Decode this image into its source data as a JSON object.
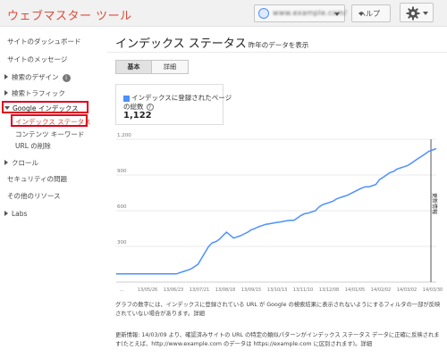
{
  "header": {
    "app_title": "ウェブマスター ツール",
    "site_selector": "www.example.com/",
    "help_label": "ヘルプ"
  },
  "sidebar": {
    "items": [
      {
        "label": "サイトのダッシュボード"
      },
      {
        "label": "サイトのメッセージ"
      },
      {
        "label": "検索のデザイン"
      },
      {
        "label": "検索トラフィック"
      },
      {
        "label": "Google インデックス"
      },
      {
        "label": "インデックス ステータス"
      },
      {
        "label": "コンテンツ キーワード"
      },
      {
        "label": "URL の削除"
      },
      {
        "label": "クロール"
      },
      {
        "label": "セキュリティの問題"
      },
      {
        "label": "その他のリソース"
      },
      {
        "label": "Labs"
      }
    ]
  },
  "main": {
    "title": "インデックス ステータス",
    "subtitle": "昨年のデータを表示",
    "tabs": [
      {
        "label": "基本"
      },
      {
        "label": "詳細"
      }
    ],
    "stat": {
      "label_line1": "インデックスに登録されたページ",
      "label_line2": "の総数",
      "value": "1,122",
      "legend_color": "#4d90fe"
    },
    "note1": "グラフの数字には、インデックスに登録されている URL が Google の検索結果に表示されないようにするフィルタの一部が反映されていない場合があります。詳細",
    "note2": "更新情報: 14/03/09 より、確認済みサイトの URL の特定の類似パターンがインデックス ステータス データに正確に反映されます(たとえば、http://www.example.com のデータは https://example.com に区別されます)。詳細"
  },
  "chart_data": {
    "type": "line",
    "ylim": [
      0,
      1200
    ],
    "y_ticks": [
      300,
      600,
      900,
      1200
    ],
    "y_tick_labels": [
      "300",
      "600",
      "900",
      "1,200"
    ],
    "x_tick_labels": [
      "...",
      "13/05/26",
      "13/06/23",
      "13/07/21",
      "13/08/18",
      "13/09/15",
      "13/10/13",
      "13/11/10",
      "13/12/08",
      "14/01/05",
      "14/02/02",
      "14/03/02",
      "14/03/30"
    ],
    "annotation": "更新情報",
    "annotation_x_index": 88.5,
    "series": [
      {
        "color": "#4d90fe",
        "values": [
          70,
          70,
          70,
          70,
          70,
          70,
          70,
          70,
          70,
          70,
          70,
          70,
          70,
          70,
          70,
          70,
          70,
          70,
          80,
          90,
          100,
          110,
          130,
          150,
          200,
          250,
          300,
          330,
          340,
          360,
          390,
          420,
          395,
          370,
          380,
          390,
          405,
          420,
          440,
          450,
          465,
          475,
          485,
          490,
          495,
          500,
          505,
          510,
          515,
          520,
          520,
          540,
          560,
          575,
          580,
          590,
          600,
          630,
          650,
          660,
          670,
          680,
          700,
          710,
          720,
          730,
          745,
          760,
          775,
          790,
          800,
          800,
          810,
          820,
          860,
          880,
          900,
          920,
          930,
          950,
          960,
          970,
          980,
          1000,
          1020,
          1040,
          1060,
          1080,
          1100,
          1110,
          1122
        ]
      }
    ]
  }
}
